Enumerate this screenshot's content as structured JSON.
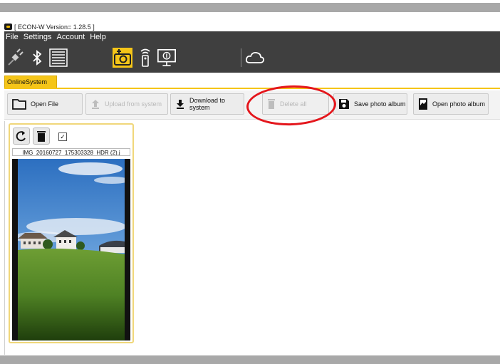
{
  "window": {
    "title": "[ ECON-W Version= 1.28.5 ]"
  },
  "menu": [
    "File",
    "Settings",
    "Account",
    "Help"
  ],
  "toolbar_icons": [
    "plug-icon",
    "bluetooth-icon",
    "list-icon",
    "camera-icon",
    "remote-icon",
    "monitor-icon",
    "cloud-icon"
  ],
  "tab": {
    "label": "OnlineSystem"
  },
  "buttons": {
    "open_file": "Open File",
    "upload": "Upload from system",
    "download": "Download to system",
    "delete_all": "Delete all",
    "save_album": "Save photo album",
    "open_album": "Open photo album"
  },
  "photo": {
    "filename": "IMG_20160727_175303328_HDR (2).j",
    "selected": true
  },
  "colors": {
    "toolbar": "#3f3f3f",
    "accent": "#f5c518",
    "highlight": "#e4161c"
  }
}
